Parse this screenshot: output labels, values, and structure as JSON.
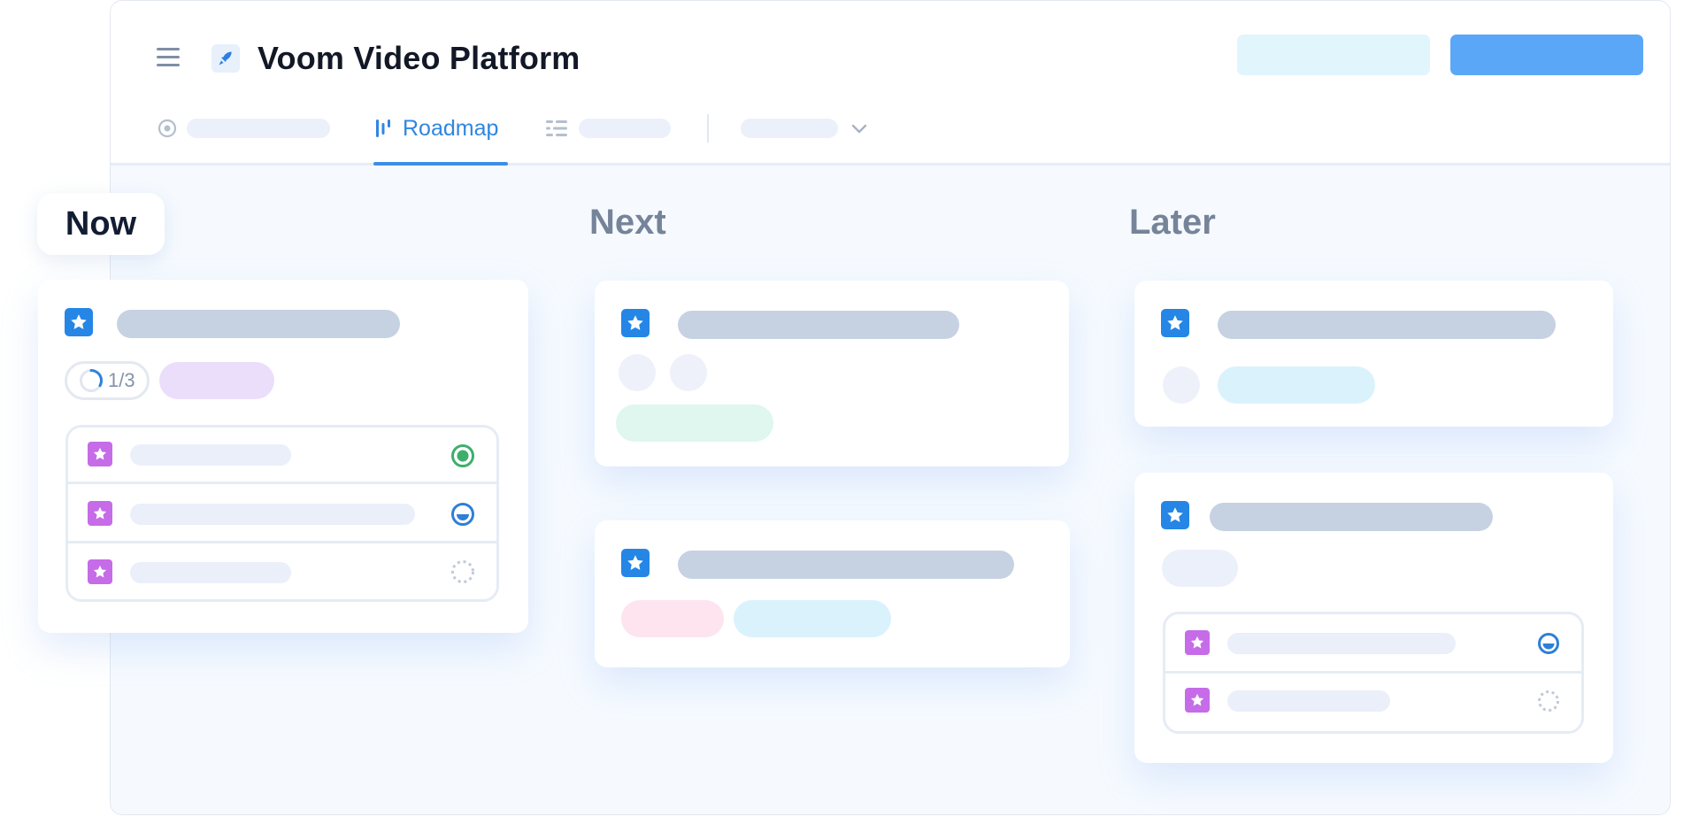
{
  "app": {
    "title": "Voom Video Platform",
    "logo_icon": "rocket-icon",
    "menu_icon": "hamburger-menu-icon"
  },
  "tabs": {
    "active": {
      "label": "Roadmap",
      "icon": "roadmap-icon"
    },
    "dropdown_icon": "chevron-down-icon"
  },
  "columns": {
    "now": "Now",
    "next": "Next",
    "later": "Later"
  },
  "now_card": {
    "progress": "1/3",
    "progress_fraction": 0.33,
    "subitem_statuses": [
      "complete",
      "in-progress",
      "not-started"
    ]
  },
  "later_card_2": {
    "subitem_statuses": [
      "in-progress",
      "not-started"
    ]
  },
  "colors": {
    "accent": "#2586e5",
    "primary_button": "#5ba7f7",
    "secondary_button": "#e1f5fd",
    "subitem_star": "#c66ce8",
    "status_complete": "#3daf6c",
    "status_in_progress": "#2e7fd6",
    "chip_purple": "#ebdefb",
    "chip_green": "#dff7ee",
    "chip_pink": "#fde4ef",
    "chip_cyan": "#daf2fc"
  }
}
